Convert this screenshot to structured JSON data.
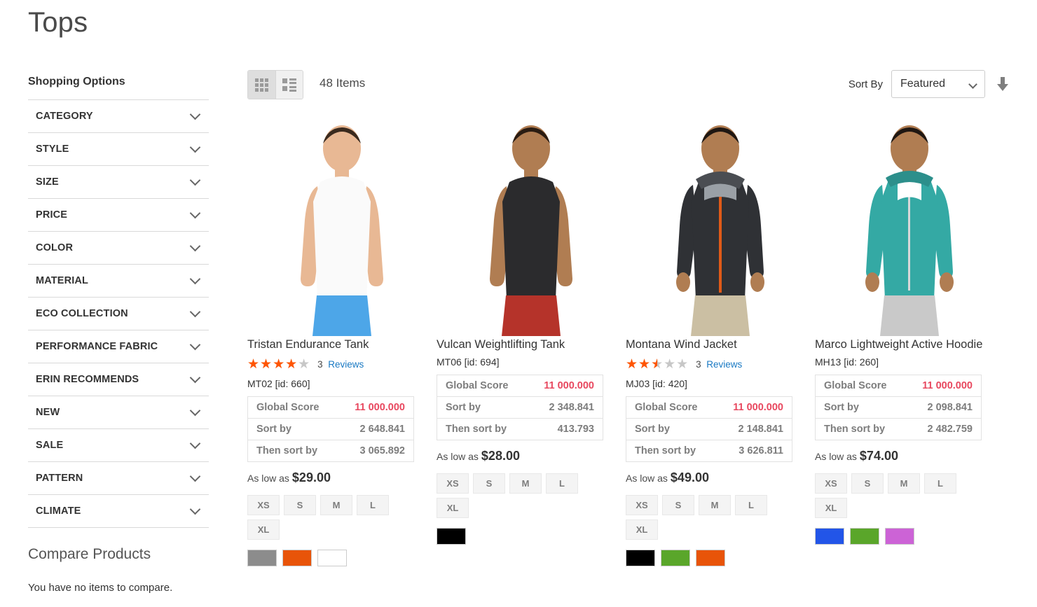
{
  "page": {
    "title": "Tops"
  },
  "sidebar": {
    "title": "Shopping Options",
    "filters": [
      {
        "label": "CATEGORY"
      },
      {
        "label": "STYLE"
      },
      {
        "label": "SIZE"
      },
      {
        "label": "PRICE"
      },
      {
        "label": "COLOR"
      },
      {
        "label": "MATERIAL"
      },
      {
        "label": "ECO COLLECTION"
      },
      {
        "label": "PERFORMANCE FABRIC"
      },
      {
        "label": "ERIN RECOMMENDS"
      },
      {
        "label": "NEW"
      },
      {
        "label": "SALE"
      },
      {
        "label": "PATTERN"
      },
      {
        "label": "CLIMATE"
      }
    ],
    "compare": {
      "title": "Compare Products",
      "empty_message": "You have no items to compare."
    }
  },
  "toolbar": {
    "view_modes": [
      {
        "name": "grid",
        "icon": "grid-icon",
        "active": true
      },
      {
        "name": "list",
        "icon": "list-icon",
        "active": false
      }
    ],
    "item_count": "48 Items",
    "sort_label": "Sort By",
    "sort_value": "Featured",
    "sort_options": [
      "Featured"
    ],
    "sort_direction_icon": "arrow-down-icon"
  },
  "colors": {
    "star_filled": "#ff5501",
    "star_empty": "#c7c7c7",
    "link": "#1979c3",
    "score_highlight": "#e8485f",
    "swatch_border": "#cccccc"
  },
  "labels": {
    "global_score": "Global Score",
    "sort_by": "Sort by",
    "then_sort_by": "Then sort by",
    "as_low_as": "As low as",
    "reviews": "Reviews"
  },
  "products": [
    {
      "name": "Tristan Endurance Tank",
      "has_rating": true,
      "rating_percent": 80,
      "review_count": "3",
      "sku": "MT02 [id: 660]",
      "global_score": "11 000.000",
      "sort_by": "2 648.841",
      "then_sort_by": "3 065.892",
      "price": "$29.00",
      "sizes": [
        "XS",
        "S",
        "M",
        "L",
        "XL"
      ],
      "swatches": [
        "#8c8c8c",
        "#e85409",
        "#ffffff"
      ],
      "image": {
        "alt": "Man wearing white sleeveless tank and blue shorts",
        "shirt": "#fafafa",
        "pants": "#4da6e8",
        "skin": "#e8b894",
        "hair": "#3a2a1e"
      }
    },
    {
      "name": "Vulcan Weightlifting Tank",
      "has_rating": false,
      "rating_percent": 0,
      "review_count": "",
      "sku": "MT06 [id: 694]",
      "global_score": "11 000.000",
      "sort_by": "2 348.841",
      "then_sort_by": "413.793",
      "price": "$28.00",
      "sizes": [
        "XS",
        "S",
        "M",
        "L",
        "XL"
      ],
      "swatches": [
        "#000000"
      ],
      "image": {
        "alt": "Man wearing black sleeveless tank and red shorts",
        "shirt": "#2b2b2d",
        "pants": "#b5332a",
        "skin": "#b07d52",
        "hair": "#2a1c12"
      }
    },
    {
      "name": "Montana Wind Jacket",
      "has_rating": true,
      "rating_percent": 50,
      "review_count": "3",
      "sku": "MJ03 [id: 420]",
      "global_score": "11 000.000",
      "sort_by": "2 148.841",
      "then_sort_by": "3 626.811",
      "price": "$49.00",
      "sizes": [
        "XS",
        "S",
        "M",
        "L",
        "XL"
      ],
      "swatches": [
        "#000000",
        "#5aa62a",
        "#e85409"
      ],
      "image": {
        "alt": "Man wearing dark puffer jacket with orange zipper and khaki pants",
        "shirt": "#2f3135",
        "pants": "#cbbfa3",
        "skin": "#b07d52",
        "hair": "#1f1712"
      }
    },
    {
      "name": "Marco Lightweight Active Hoodie",
      "has_rating": false,
      "rating_percent": 0,
      "review_count": "",
      "sku": "MH13 [id: 260]",
      "global_score": "11 000.000",
      "sort_by": "2 098.841",
      "then_sort_by": "2 482.759",
      "price": "$74.00",
      "sizes": [
        "XS",
        "S",
        "M",
        "L",
        "XL"
      ],
      "swatches": [
        "#2255e8",
        "#5aa62a",
        "#cc63d6"
      ],
      "image": {
        "alt": "Man wearing teal zip hoodie and gray sweatpants",
        "shirt": "#34a9a4",
        "pants": "#c9c9c9",
        "skin": "#b07d52",
        "hair": "#1f1712"
      }
    }
  ]
}
